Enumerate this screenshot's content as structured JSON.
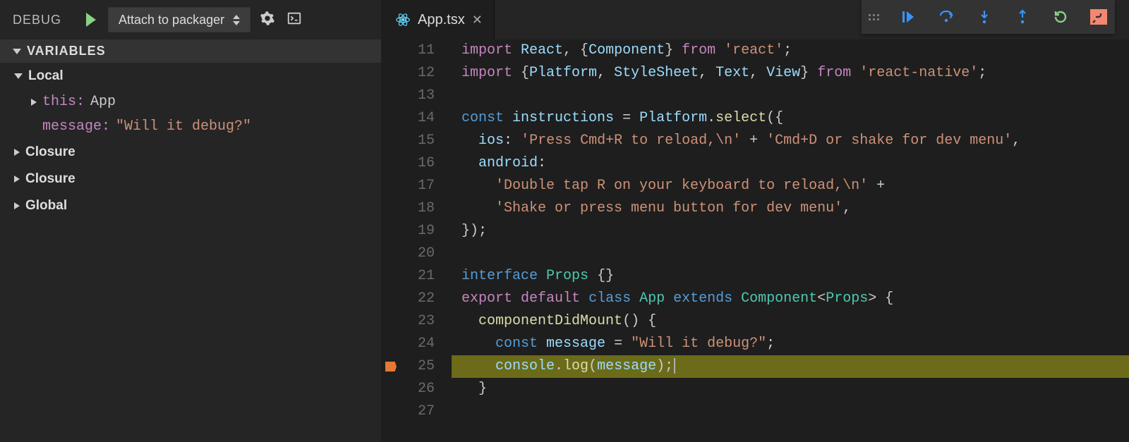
{
  "sidebar": {
    "title": "DEBUG",
    "config_label": "Attach to packager",
    "sections": {
      "variables": {
        "label": "VARIABLES",
        "scopes": [
          {
            "name": "Local",
            "expanded": true,
            "vars": [
              {
                "name": "this",
                "value": "App",
                "type": "obj",
                "expandable": true
              },
              {
                "name": "message",
                "value": "\"Will it debug?\"",
                "type": "str",
                "expandable": false
              }
            ]
          },
          {
            "name": "Closure",
            "expanded": false
          },
          {
            "name": "Closure",
            "expanded": false
          },
          {
            "name": "Global",
            "expanded": false
          }
        ]
      }
    }
  },
  "tab": {
    "filename": "App.tsx"
  },
  "editor": {
    "breakpoint_line": 25,
    "current_line": 25,
    "first_line": 11,
    "lines": [
      {
        "n": 11,
        "tokens": [
          [
            "kw2",
            "import"
          ],
          [
            "c1",
            " "
          ],
          [
            "var",
            "React"
          ],
          [
            "pn",
            ", {"
          ],
          [
            "var",
            "Component"
          ],
          [
            "pn",
            "} "
          ],
          [
            "kw2",
            "from"
          ],
          [
            "c1",
            " "
          ],
          [
            "str",
            "'react'"
          ],
          [
            "pn",
            ";"
          ]
        ]
      },
      {
        "n": 12,
        "tokens": [
          [
            "kw2",
            "import"
          ],
          [
            "c1",
            " "
          ],
          [
            "pn",
            "{"
          ],
          [
            "var",
            "Platform"
          ],
          [
            "pn",
            ", "
          ],
          [
            "var",
            "StyleSheet"
          ],
          [
            "pn",
            ", "
          ],
          [
            "var",
            "Text"
          ],
          [
            "pn",
            ", "
          ],
          [
            "var",
            "View"
          ],
          [
            "pn",
            "} "
          ],
          [
            "kw2",
            "from"
          ],
          [
            "c1",
            " "
          ],
          [
            "str",
            "'react-native'"
          ],
          [
            "pn",
            ";"
          ]
        ]
      },
      {
        "n": 13,
        "tokens": []
      },
      {
        "n": 14,
        "tokens": [
          [
            "kw",
            "const"
          ],
          [
            "c1",
            " "
          ],
          [
            "var",
            "instructions"
          ],
          [
            "c1",
            " "
          ],
          [
            "op",
            "="
          ],
          [
            "c1",
            " "
          ],
          [
            "var",
            "Platform"
          ],
          [
            "pn",
            "."
          ],
          [
            "fn",
            "select"
          ],
          [
            "pn",
            "({"
          ]
        ]
      },
      {
        "n": 15,
        "tokens": [
          [
            "c1",
            "  "
          ],
          [
            "prop",
            "ios"
          ],
          [
            "pn",
            ":"
          ],
          [
            "c1",
            " "
          ],
          [
            "str",
            "'Press Cmd+R to reload,\\n'"
          ],
          [
            "c1",
            " "
          ],
          [
            "op",
            "+"
          ],
          [
            "c1",
            " "
          ],
          [
            "str",
            "'Cmd+D or shake for dev menu'"
          ],
          [
            "pn",
            ","
          ]
        ]
      },
      {
        "n": 16,
        "tokens": [
          [
            "c1",
            "  "
          ],
          [
            "prop",
            "android"
          ],
          [
            "pn",
            ":"
          ]
        ]
      },
      {
        "n": 17,
        "tokens": [
          [
            "c1",
            "    "
          ],
          [
            "str",
            "'Double tap R on your keyboard to reload,\\n'"
          ],
          [
            "c1",
            " "
          ],
          [
            "op",
            "+"
          ]
        ]
      },
      {
        "n": 18,
        "tokens": [
          [
            "c1",
            "    "
          ],
          [
            "str",
            "'Shake or press menu button for dev menu'"
          ],
          [
            "pn",
            ","
          ]
        ]
      },
      {
        "n": 19,
        "tokens": [
          [
            "pn",
            "});"
          ]
        ]
      },
      {
        "n": 20,
        "tokens": []
      },
      {
        "n": 21,
        "tokens": [
          [
            "kw",
            "interface"
          ],
          [
            "c1",
            " "
          ],
          [
            "ty",
            "Props"
          ],
          [
            "c1",
            " "
          ],
          [
            "pn",
            "{}"
          ]
        ]
      },
      {
        "n": 22,
        "tokens": [
          [
            "kw2",
            "export"
          ],
          [
            "c1",
            " "
          ],
          [
            "kw2",
            "default"
          ],
          [
            "c1",
            " "
          ],
          [
            "kw",
            "class"
          ],
          [
            "c1",
            " "
          ],
          [
            "ty",
            "App"
          ],
          [
            "c1",
            " "
          ],
          [
            "kw",
            "extends"
          ],
          [
            "c1",
            " "
          ],
          [
            "ty",
            "Component"
          ],
          [
            "pn",
            "<"
          ],
          [
            "ty",
            "Props"
          ],
          [
            "pn",
            "> {"
          ]
        ]
      },
      {
        "n": 23,
        "tokens": [
          [
            "c1",
            "  "
          ],
          [
            "fn",
            "componentDidMount"
          ],
          [
            "pn",
            "() {"
          ]
        ]
      },
      {
        "n": 24,
        "tokens": [
          [
            "c1",
            "    "
          ],
          [
            "kw",
            "const"
          ],
          [
            "c1",
            " "
          ],
          [
            "var",
            "message"
          ],
          [
            "c1",
            " "
          ],
          [
            "op",
            "="
          ],
          [
            "c1",
            " "
          ],
          [
            "str",
            "\"Will it debug?\""
          ],
          [
            "pn",
            ";"
          ]
        ]
      },
      {
        "n": 25,
        "tokens": [
          [
            "c1",
            "    "
          ],
          [
            "var",
            "console"
          ],
          [
            "pn",
            "."
          ],
          [
            "fn",
            "log"
          ],
          [
            "pn",
            "("
          ],
          [
            "var",
            "message"
          ],
          [
            "pn",
            ");"
          ]
        ]
      },
      {
        "n": 26,
        "tokens": [
          [
            "c1",
            "  "
          ],
          [
            "pn",
            "}"
          ]
        ]
      },
      {
        "n": 27,
        "tokens": []
      }
    ]
  }
}
